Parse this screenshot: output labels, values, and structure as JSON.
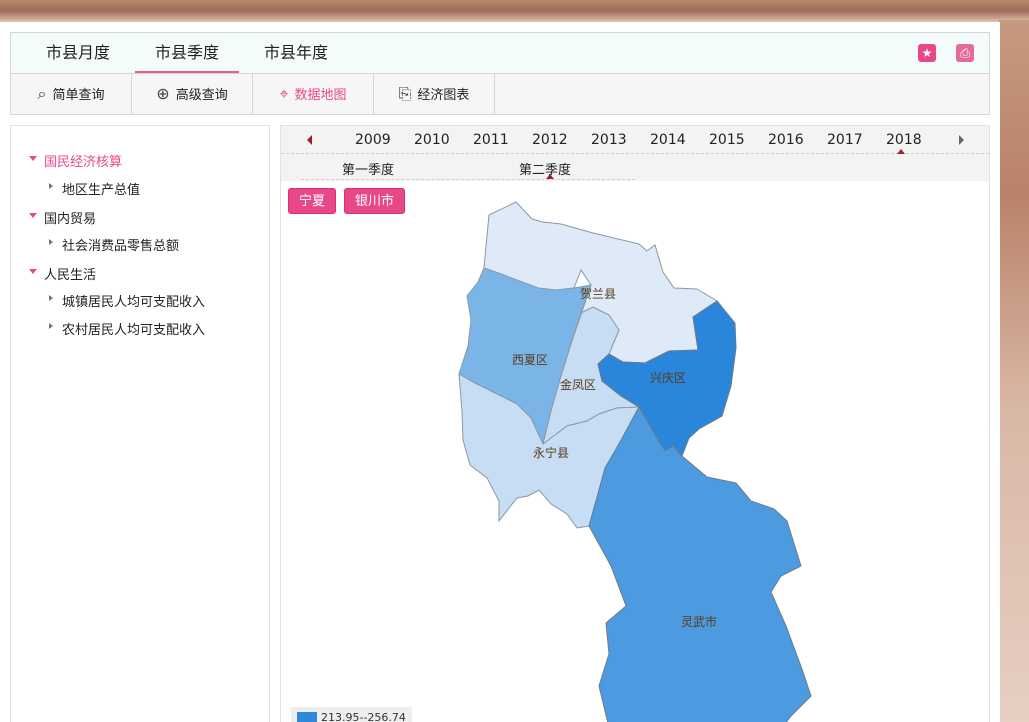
{
  "top_tabs": [
    {
      "label": "市县月度",
      "active": false
    },
    {
      "label": "市县季度",
      "active": true
    },
    {
      "label": "市县年度",
      "active": false
    }
  ],
  "toolbar": {
    "items": [
      {
        "label": "简单查询",
        "icon": "search-icon",
        "active": false
      },
      {
        "label": "高级查询",
        "icon": "zoom-in-icon",
        "active": false
      },
      {
        "label": "数据地图",
        "icon": "map-pin-icon",
        "active": true
      },
      {
        "label": "经济图表",
        "icon": "chart-icon",
        "active": false
      }
    ],
    "right_icons": [
      "star-icon",
      "print-icon"
    ]
  },
  "sidebar": {
    "groups": [
      {
        "label": "国民经济核算",
        "active": true,
        "children": [
          "地区生产总值"
        ]
      },
      {
        "label": "国内贸易",
        "active": false,
        "children": [
          "社会消费品零售总额"
        ]
      },
      {
        "label": "人民生活",
        "active": false,
        "children": [
          "城镇居民人均可支配收入",
          "农村居民人均可支配收入"
        ]
      }
    ]
  },
  "timeline": {
    "years": [
      "2009",
      "2010",
      "2011",
      "2012",
      "2013",
      "2014",
      "2015",
      "2016",
      "2017",
      "2018"
    ],
    "selected_year": "2018",
    "quarters": [
      "第一季度",
      "第二季度"
    ],
    "selected_quarter": "第二季度"
  },
  "breadcrumbs": [
    "宁夏",
    "银川市"
  ],
  "map": {
    "regions": [
      {
        "name": "贺兰县",
        "color": "#deeaf7"
      },
      {
        "name": "西夏区",
        "color": "#7bb5e8"
      },
      {
        "name": "金凤区",
        "color": "#c6ddf3"
      },
      {
        "name": "兴庆区",
        "color": "#2a86da"
      },
      {
        "name": "永宁县",
        "color": "#c6ddf3"
      },
      {
        "name": "灵武市",
        "color": "#4c9be0"
      }
    ]
  },
  "legend": {
    "label": "213.95--256.74",
    "color": "#2f88da"
  },
  "colors": {
    "accent": "#e8488a",
    "marker": "#a61c2e"
  }
}
